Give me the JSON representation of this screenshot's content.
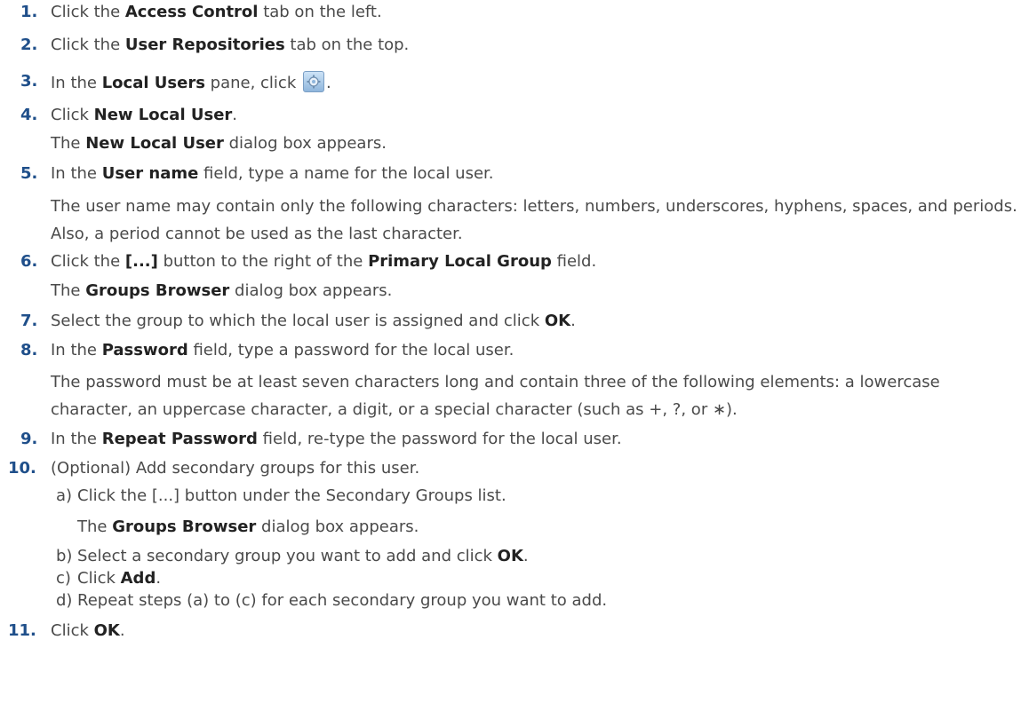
{
  "steps": [
    {
      "n": "1.",
      "a": "Click the ",
      "b": "Access Control",
      "c": " tab on the left."
    },
    {
      "n": "2.",
      "a": "Click the ",
      "b": "User Repositories",
      "c": " tab on the top."
    },
    {
      "n": "3.",
      "a": "In the ",
      "b": "Local Users",
      "c": " pane, click ",
      "d": "."
    },
    {
      "n": "4.",
      "a": "Click ",
      "b": "New Local User",
      "c": "."
    },
    {
      "n": "5.",
      "a": "In the ",
      "b": "User name",
      "c": " field, type a name for the local user."
    },
    {
      "n": "6.",
      "a": "Click the ",
      "b": "[...]",
      "c": " button to the right of the ",
      "d": "Primary Local Group",
      "e": " field."
    },
    {
      "n": "7.",
      "a": "Select the group to which the local user is assigned and click ",
      "b": "OK",
      "c": "."
    },
    {
      "n": "8.",
      "a": "In the ",
      "b": "Password",
      "c": " field, type a password for the local user."
    },
    {
      "n": "9.",
      "a": "In the ",
      "b": "Repeat Password",
      "c": " field, re-type the password for the local user."
    },
    {
      "n": "10.",
      "a": "(Optional) Add secondary groups for this user."
    },
    {
      "n": "11.",
      "a": "Click ",
      "b": "OK",
      "c": "."
    }
  ],
  "notes": {
    "n4": {
      "a": "The ",
      "b": "New Local User",
      "c": " dialog box appears."
    },
    "n5": "The user name may contain only the following characters: letters, numbers, underscores, hyphens, spaces, and periods. Also, a period cannot be used as the last character.",
    "n6": {
      "a": "The ",
      "b": "Groups Browser",
      "c": " dialog box appears."
    },
    "n8": "The password must be at least seven characters long and contain three of the following elements: a lowercase character, an uppercase character, a digit, or a special character (such as +, ?, or ∗).",
    "n10a": {
      "a": "The ",
      "b": "Groups Browser",
      "c": " dialog box appears."
    }
  },
  "substeps": [
    {
      "l": "a)",
      "a": "Click the [...] button under the Secondary Groups list."
    },
    {
      "l": "b)",
      "a": "Select a secondary group you want to add and click ",
      "b": "OK",
      "c": "."
    },
    {
      "l": "c)",
      "a": "Click ",
      "b": "Add",
      "c": "."
    },
    {
      "l": "d)",
      "a": "Repeat steps (a) to (c) for each secondary group you want to add."
    }
  ],
  "icons": {
    "settings": "gear-icon"
  },
  "colors": {
    "step_number": "#1f4f8a",
    "body_text": "#4a4a4a",
    "bold_text": "#222222"
  }
}
